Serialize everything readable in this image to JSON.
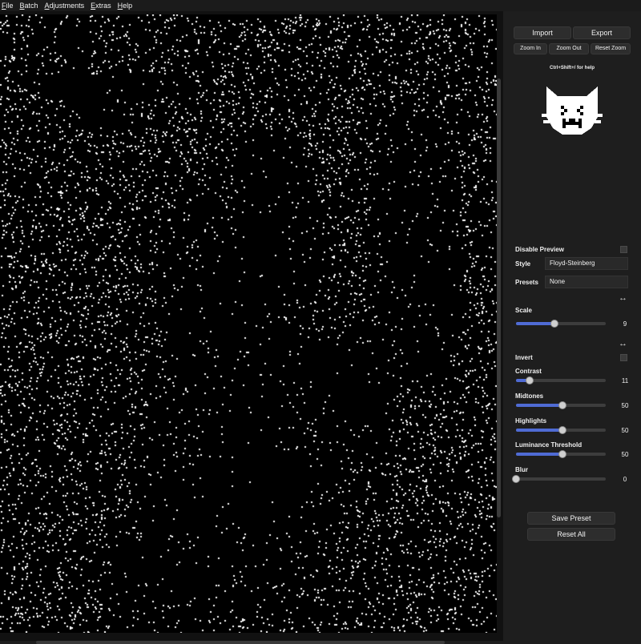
{
  "menubar": {
    "items": [
      {
        "label": "File",
        "icon": "menu-file"
      },
      {
        "label": "Batch",
        "icon": "menu-batch"
      },
      {
        "label": "Adjustments",
        "icon": "menu-adjustments"
      },
      {
        "label": "Extras",
        "icon": "menu-extras"
      },
      {
        "label": "Help",
        "icon": "menu-help"
      }
    ]
  },
  "toolbar": {
    "import_label": "Import",
    "export_label": "Export",
    "zoom_in_label": "Zoom In",
    "zoom_out_label": "Zoom Out",
    "reset_zoom_label": "Reset Zoom",
    "help_text": "Ctrl+Shift+/ for help"
  },
  "logo": {
    "icon": "laughing-cat-icon"
  },
  "settings": {
    "disable_preview_label": "Disable Preview",
    "disable_preview_checked": false,
    "style_label": "Style",
    "style_value": "Floyd-Steinberg",
    "presets_label": "Presets",
    "presets_value": "None",
    "expand_icon": "horizontal-arrows-icon",
    "scale_label": "Scale",
    "scale_value": "9",
    "scale_fraction": 0.43,
    "invert_label": "Invert",
    "invert_checked": false,
    "contrast_label": "Contrast",
    "contrast_value": "11",
    "contrast_fraction": 0.155,
    "midtones_label": "Midtones",
    "midtones_value": "50",
    "midtones_fraction": 0.52,
    "highlights_label": "Highlights",
    "highlights_value": "50",
    "highlights_fraction": 0.52,
    "luminance_threshold_label": "Luminance Threshold",
    "luminance_threshold_value": "50",
    "luminance_threshold_fraction": 0.52,
    "blur_label": "Blur",
    "blur_value": "0",
    "blur_fraction": 0.0
  },
  "actions": {
    "save_preset_label": "Save Preset",
    "reset_all_label": "Reset All"
  },
  "colors": {
    "background": "#1e1e1e",
    "menubar": "#1b1b1b",
    "button": "#2d2d2d",
    "slider_fill": "#4f6bd4",
    "slider_track": "#3d3d3d",
    "canvas_dark": "#000000",
    "canvas_dot": "#ffffff"
  }
}
